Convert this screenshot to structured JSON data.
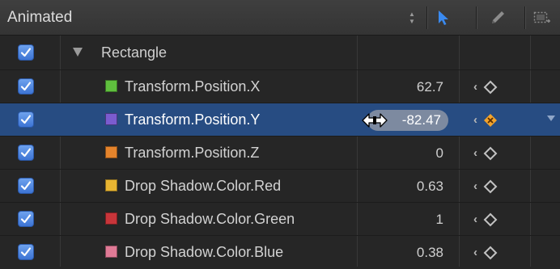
{
  "header": {
    "title": "Animated",
    "icons": [
      "up-down-arrows-icon",
      "arrow-cursor-icon",
      "pencil-icon",
      "marquee-select-icon"
    ]
  },
  "colors": {
    "selection": "#274c82",
    "checkbox": "#4f86e0",
    "arrow_tool": "#3a8af0",
    "keyframe_active": "#f3a32b"
  },
  "group": {
    "label": "Rectangle",
    "expanded": true,
    "checked": true
  },
  "rows": [
    {
      "label": "Transform.Position.X",
      "value": "62.7",
      "swatch": "#5fbf3e",
      "checked": true,
      "selected": false,
      "keyframe": false
    },
    {
      "label": "Transform.Position.Y",
      "value": "-82.47",
      "swatch": "#7b5ccf",
      "checked": true,
      "selected": true,
      "keyframe": true
    },
    {
      "label": "Transform.Position.Z",
      "value": "0",
      "swatch": "#e5842c",
      "checked": true,
      "selected": false,
      "keyframe": false
    },
    {
      "label": "Drop Shadow.Color.Red",
      "value": "0.63",
      "swatch": "#e8b532",
      "checked": true,
      "selected": false,
      "keyframe": false
    },
    {
      "label": "Drop Shadow.Color.Green",
      "value": "1",
      "swatch": "#c8353a",
      "checked": true,
      "selected": false,
      "keyframe": false
    },
    {
      "label": "Drop Shadow.Color.Blue",
      "value": "0.38",
      "swatch": "#e07a96",
      "checked": true,
      "selected": false,
      "keyframe": false
    }
  ]
}
